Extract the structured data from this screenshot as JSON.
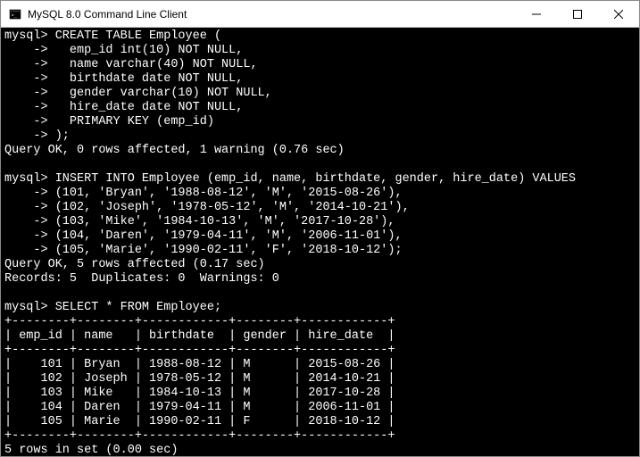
{
  "window": {
    "title": "MySQL 8.0 Command Line Client"
  },
  "terminal": {
    "lines": [
      "mysql> CREATE TABLE Employee (",
      "    ->   emp_id int(10) NOT NULL,",
      "    ->   name varchar(40) NOT NULL,",
      "    ->   birthdate date NOT NULL,",
      "    ->   gender varchar(10) NOT NULL,",
      "    ->   hire_date date NOT NULL,",
      "    ->   PRIMARY KEY (emp_id)",
      "    -> );",
      "Query OK, 0 rows affected, 1 warning (0.76 sec)",
      "",
      "mysql> INSERT INTO Employee (emp_id, name, birthdate, gender, hire_date) VALUES",
      "    -> (101, 'Bryan', '1988-08-12', 'M', '2015-08-26'),",
      "    -> (102, 'Joseph', '1978-05-12', 'M', '2014-10-21'),",
      "    -> (103, 'Mike', '1984-10-13', 'M', '2017-10-28'),",
      "    -> (104, 'Daren', '1979-04-11', 'M', '2006-11-01'),",
      "    -> (105, 'Marie', '1990-02-11', 'F', '2018-10-12');",
      "Query OK, 5 rows affected (0.17 sec)",
      "Records: 5  Duplicates: 0  Warnings: 0",
      "",
      "mysql> SELECT * FROM Employee;",
      "+--------+--------+------------+--------+------------+",
      "| emp_id | name   | birthdate  | gender | hire_date  |",
      "+--------+--------+------------+--------+------------+",
      "|    101 | Bryan  | 1988-08-12 | M      | 2015-08-26 |",
      "|    102 | Joseph | 1978-05-12 | M      | 2014-10-21 |",
      "|    103 | Mike   | 1984-10-13 | M      | 2017-10-28 |",
      "|    104 | Daren  | 1979-04-11 | M      | 2006-11-01 |",
      "|    105 | Marie  | 1990-02-11 | F      | 2018-10-12 |",
      "+--------+--------+------------+--------+------------+",
      "5 rows in set (0.00 sec)"
    ]
  },
  "chart_data": {
    "type": "table",
    "title": "Employee",
    "columns": [
      "emp_id",
      "name",
      "birthdate",
      "gender",
      "hire_date"
    ],
    "rows": [
      [
        101,
        "Bryan",
        "1988-08-12",
        "M",
        "2015-08-26"
      ],
      [
        102,
        "Joseph",
        "1978-05-12",
        "M",
        "2014-10-21"
      ],
      [
        103,
        "Mike",
        "1984-10-13",
        "M",
        "2017-10-28"
      ],
      [
        104,
        "Daren",
        "1979-04-11",
        "M",
        "2006-11-01"
      ],
      [
        105,
        "Marie",
        "1990-02-11",
        "F",
        "2018-10-12"
      ]
    ]
  }
}
